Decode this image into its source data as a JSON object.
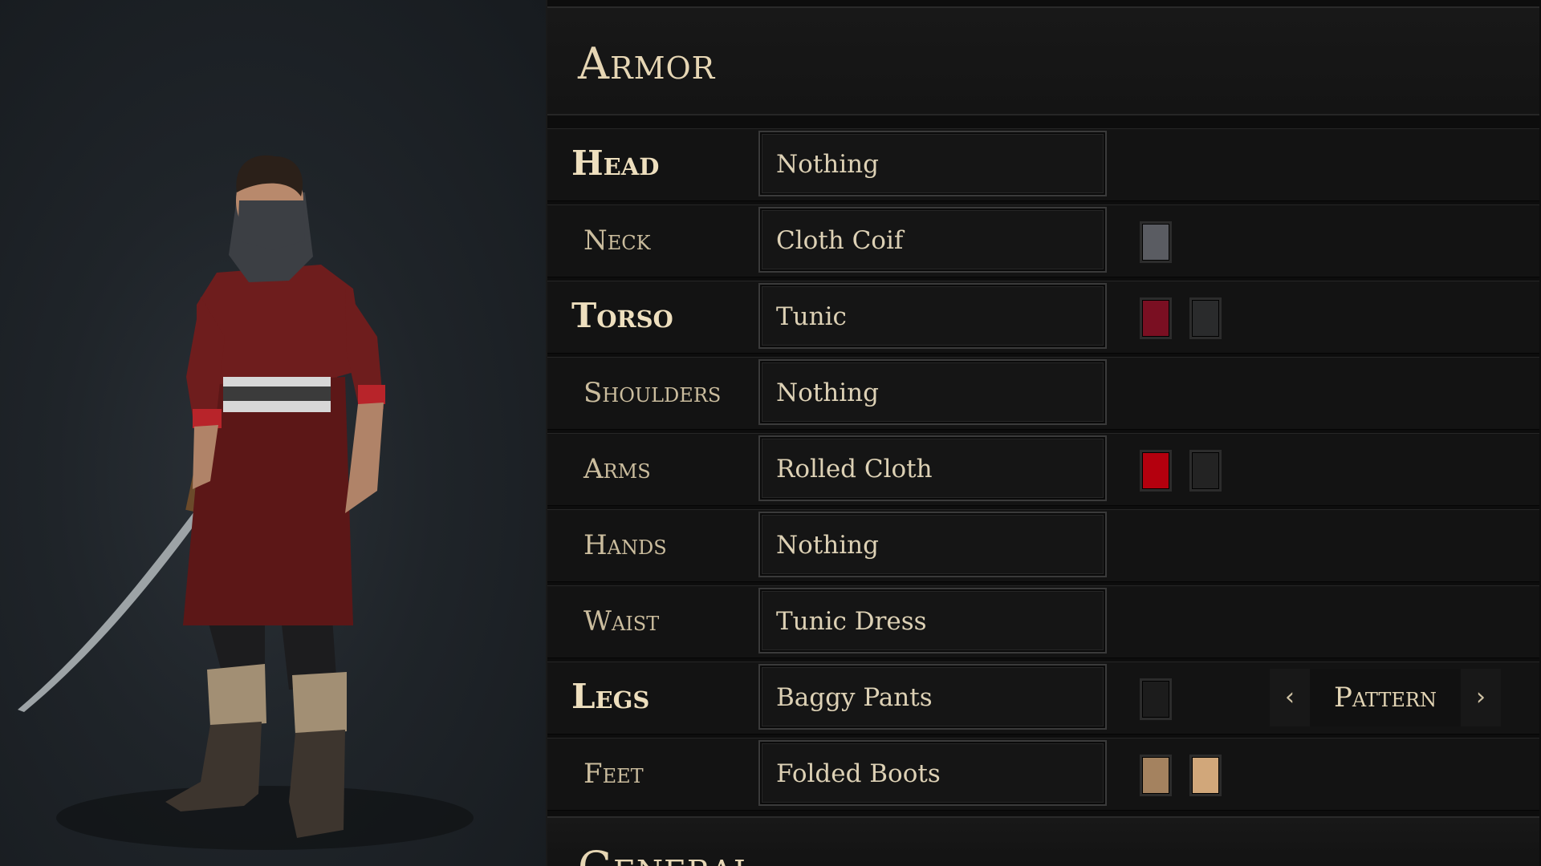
{
  "armor": {
    "title": "Armor",
    "rows": [
      {
        "label": "Head",
        "item": "Nothing",
        "colors": []
      },
      {
        "label": "Neck",
        "item": "Cloth Coif",
        "colors": [
          "#5a5c62"
        ]
      },
      {
        "label": "Torso",
        "item": "Tunic",
        "colors": [
          "#7a0f22",
          "#2a2b2c"
        ]
      },
      {
        "label": "Shoulders",
        "item": "Nothing",
        "colors": []
      },
      {
        "label": "Arms",
        "item": "Rolled Cloth",
        "colors": [
          "#b4000e",
          "#232323"
        ]
      },
      {
        "label": "Hands",
        "item": "Nothing",
        "colors": []
      },
      {
        "label": "Waist",
        "item": "Tunic Dress",
        "colors": []
      },
      {
        "label": "Legs",
        "item": "Baggy Pants",
        "colors": [
          "#1c1c1c"
        ],
        "pattern": {
          "label": "Pattern",
          "prev_icon": "chevron-left-icon",
          "next_icon": "chevron-right-icon"
        }
      },
      {
        "label": "Feet",
        "item": "Folded Boots",
        "colors": [
          "#a4825f",
          "#d1a77a"
        ]
      }
    ]
  },
  "general": {
    "title": "General"
  }
}
